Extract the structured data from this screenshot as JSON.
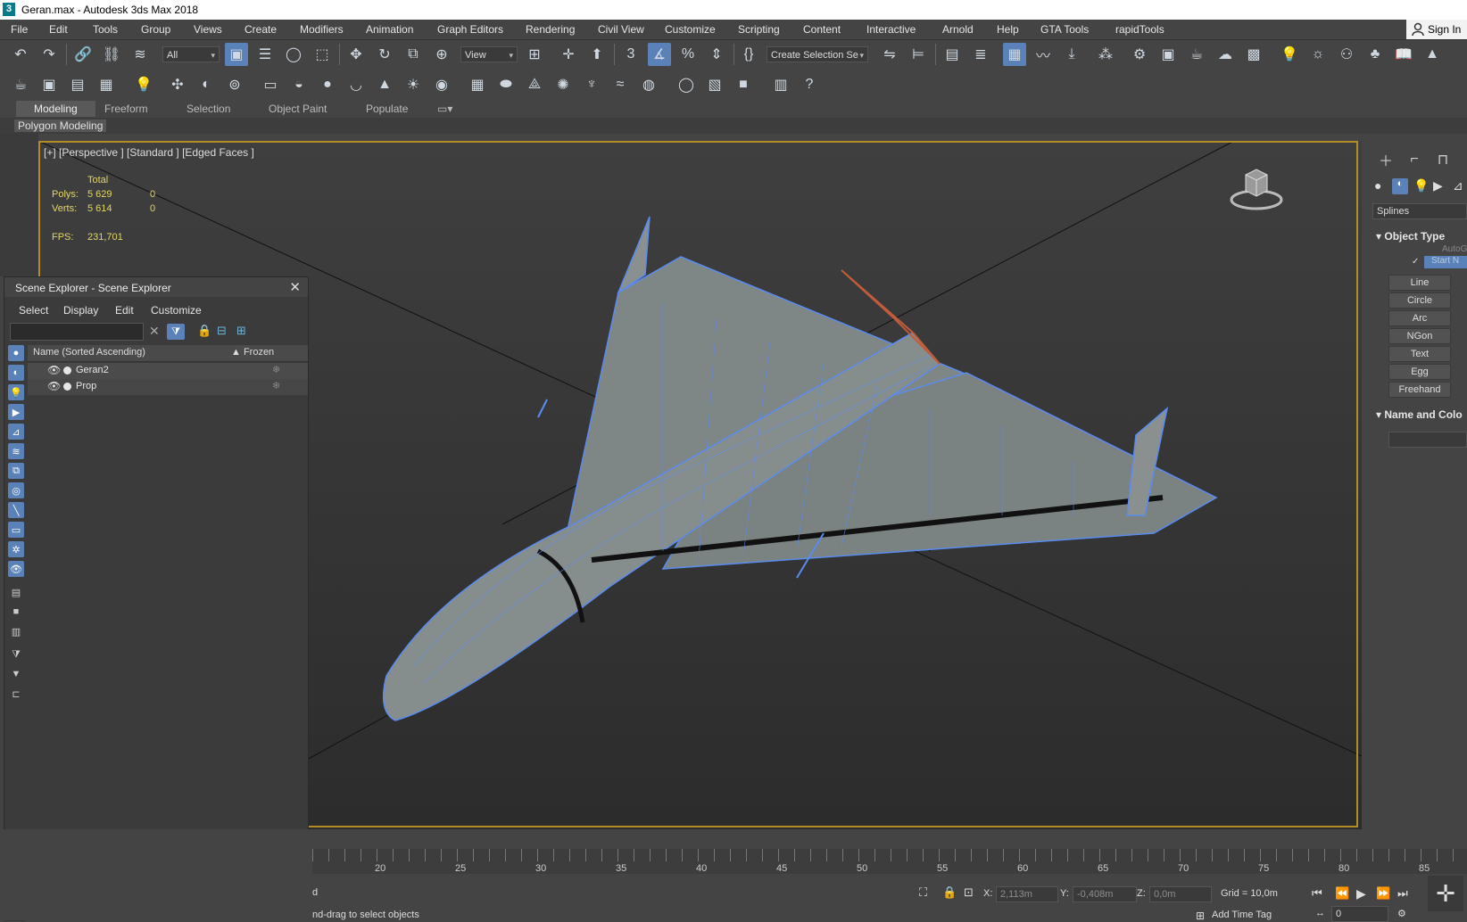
{
  "titlebar": {
    "title": "Geran.max - Autodesk 3ds Max 2018"
  },
  "menu": [
    "File",
    "Edit",
    "Tools",
    "Group",
    "Views",
    "Create",
    "Modifiers",
    "Animation",
    "Graph Editors",
    "Rendering",
    "Civil View",
    "Customize",
    "Scripting",
    "Content",
    "Interactive",
    "Arnold",
    "Help",
    "GTA Tools",
    "rapidTools"
  ],
  "signin": "Sign In",
  "toolbar": {
    "filter_value": "All",
    "view_value": "View",
    "selection_set_value": "Create Selection Se",
    "snap_label": "3"
  },
  "ribbon": {
    "tabs": [
      "Modeling",
      "Freeform",
      "Selection",
      "Object Paint",
      "Populate"
    ],
    "subtitle": "Polygon Modeling"
  },
  "viewport": {
    "label": "[+] [Perspective ] [Standard ] [Edged Faces ]",
    "stats": {
      "total_label": "Total",
      "polys_label": "Polys:",
      "polys_value": "5 629",
      "polys_sel": "0",
      "verts_label": "Verts:",
      "verts_value": "5 614",
      "verts_sel": "0",
      "fps_label": "FPS:",
      "fps_value": "231,701"
    }
  },
  "scene_explorer": {
    "title": "Scene Explorer - Scene Explorer",
    "menu": [
      "Select",
      "Display",
      "Edit",
      "Customize"
    ],
    "col_name": "Name (Sorted Ascending)",
    "col_frozen": "▲ Frozen",
    "rows": [
      {
        "name": "Geran2"
      },
      {
        "name": "Prop"
      }
    ]
  },
  "command_panel": {
    "category": "Splines",
    "object_type_header": "Object Type",
    "autogrid": "AutoGrid",
    "start_new": "Start N",
    "buttons": [
      "Line",
      "Circle",
      "Arc",
      "NGon",
      "Text",
      "Egg",
      "Freehand"
    ],
    "name_color_header": "Name and Colo"
  },
  "timeline": {
    "labels": [
      "20",
      "25",
      "30",
      "35",
      "40",
      "45",
      "50",
      "55",
      "60",
      "65",
      "70",
      "75",
      "80",
      "85"
    ]
  },
  "statusbar": {
    "prompt_top": "d",
    "prompt_bottom": "nd-drag to select objects",
    "x_label": "X:",
    "x_value": "2,113m",
    "y_label": "Y:",
    "y_value": "-0,408m",
    "z_label": "Z:",
    "z_value": "0,0m",
    "grid": "Grid = 10,0m",
    "add_time_tag": "Add Time Tag",
    "frame_value": "0"
  },
  "colors": {
    "accent": "#5b82b8",
    "viewport_border": "#b58b28",
    "stats": "#e3d66b",
    "wire": "#5a8cf0"
  }
}
